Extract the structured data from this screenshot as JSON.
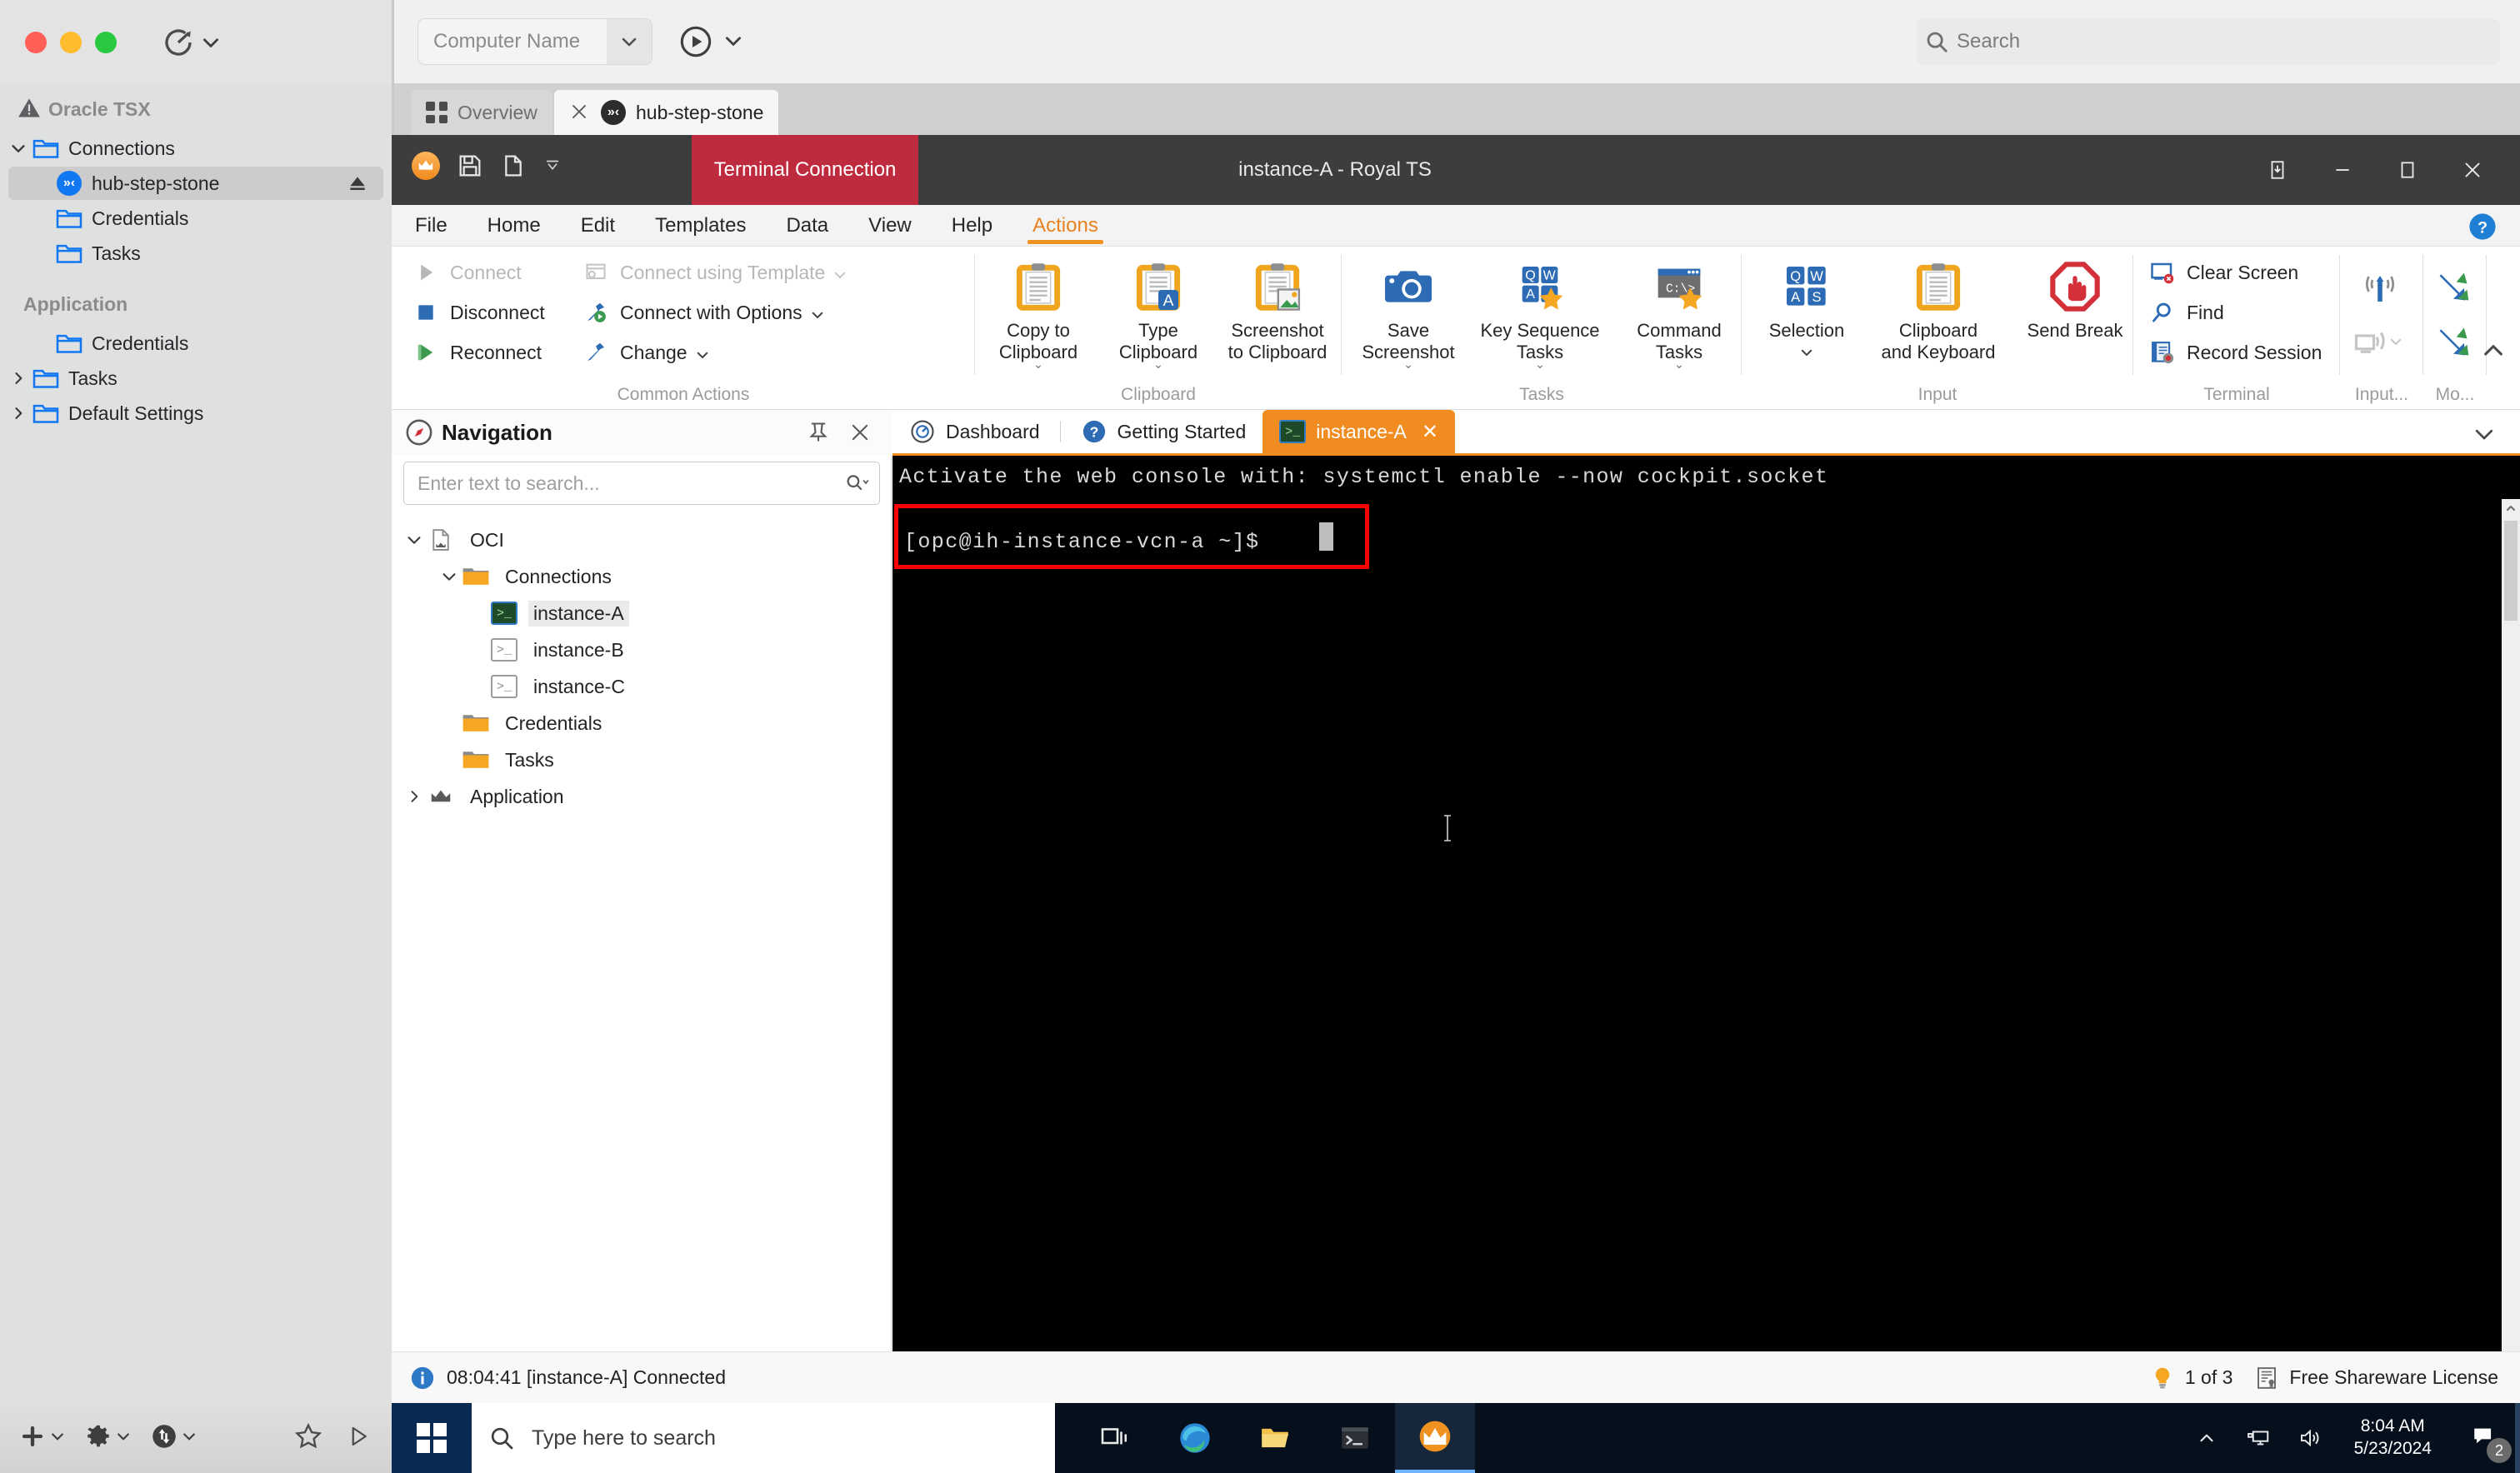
{
  "mac": {
    "toolbar": {
      "refresh_icon": "refresh-icon",
      "chevron_icon": "chevron-down-icon"
    },
    "sidebar": {
      "sections": [
        {
          "header": "Oracle TSX",
          "header_icon": "warning-triangle-icon",
          "items": [
            {
              "label": "Connections",
              "icon": "folder-icon",
              "chevron": "chevron-down-icon",
              "indent": 1,
              "selected": false
            },
            {
              "label": "hub-step-stone",
              "icon": "xshell-icon",
              "indent": 2,
              "selected": true,
              "trailing_icon": "eject-icon"
            },
            {
              "label": "Credentials",
              "icon": "folder-icon",
              "indent": 2,
              "selected": false
            },
            {
              "label": "Tasks",
              "icon": "folder-icon",
              "indent": 2,
              "selected": false
            }
          ]
        },
        {
          "header": "Application",
          "items": [
            {
              "label": "Credentials",
              "icon": "folder-icon",
              "indent": 2,
              "selected": false
            },
            {
              "label": "Tasks",
              "icon": "folder-icon",
              "chevron": "chevron-right-icon",
              "indent": 1,
              "selected": false
            },
            {
              "label": "Default Settings",
              "icon": "folder-icon",
              "chevron": "chevron-right-icon",
              "indent": 1,
              "selected": false
            }
          ]
        }
      ]
    },
    "bottombar": {
      "add_icon": "plus-icon",
      "settings_icon": "gear-icon",
      "transfer_icon": "transfer-icon",
      "favorite_icon": "star-icon",
      "run_icon": "play-triangle-icon"
    }
  },
  "vm": {
    "computer_name_placeholder": "Computer Name",
    "play_icon": "play-circle-icon",
    "search_placeholder": "Search",
    "search_icon": "search-icon",
    "tabs": [
      {
        "label": "Overview",
        "icon": "grid-icon",
        "active": false
      },
      {
        "label": "hub-step-stone",
        "icon": "xshell-icon",
        "active": true,
        "close_icon": "close-icon"
      }
    ]
  },
  "royalts": {
    "titlebar": {
      "badge": "Terminal Connection",
      "title": "instance-A - Royal TS",
      "quick_access": [
        "royal-logo-icon",
        "save-icon",
        "new-document-icon",
        "customize-chevron-icon"
      ],
      "window_controls": [
        "restore-down-icon",
        "minimize-icon",
        "maximize-icon",
        "close-icon"
      ]
    },
    "menubar": {
      "items": [
        "File",
        "Home",
        "Edit",
        "Templates",
        "Data",
        "View",
        "Help",
        "Actions"
      ],
      "active": "Actions",
      "help_icon": "help-circle-icon"
    },
    "ribbon": {
      "groups": [
        {
          "title": "Common Actions",
          "small_buttons": [
            {
              "label": "Connect",
              "icon": "play-triangle-icon",
              "disabled": true
            },
            {
              "label": "Disconnect",
              "icon": "stop-square-icon",
              "disabled": false
            },
            {
              "label": "Reconnect",
              "icon": "reconnect-icon",
              "disabled": false
            },
            {
              "label": "Connect using Template",
              "icon": "template-icon",
              "disabled": true,
              "chevron": "chevron-down-icon"
            },
            {
              "label": "Connect with Options",
              "icon": "wrench-play-icon",
              "disabled": false,
              "chevron": "chevron-down-icon"
            },
            {
              "label": "Change",
              "icon": "wrench-icon",
              "disabled": false,
              "chevron": "chevron-down-icon"
            }
          ]
        },
        {
          "title": "Clipboard",
          "big_buttons": [
            {
              "label": "Copy to\nClipboard",
              "icon": "clipboard-icon",
              "chevron": "chevron-down-icon"
            },
            {
              "label": "Type\nClipboard",
              "icon": "clipboard-type-icon",
              "chevron": "chevron-down-icon"
            },
            {
              "label": "Screenshot\nto Clipboard",
              "icon": "clipboard-image-icon"
            }
          ]
        },
        {
          "title": "Tasks",
          "big_buttons": [
            {
              "label": "Save\nScreenshot",
              "icon": "camera-icon",
              "chevron": "chevron-down-icon"
            },
            {
              "label": "Key Sequence\nTasks",
              "icon": "keys-star-icon",
              "chevron": "chevron-down-icon"
            },
            {
              "label": "Command\nTasks",
              "icon": "console-star-icon",
              "chevron": "chevron-down-icon"
            }
          ]
        },
        {
          "title": "Input",
          "big_buttons": [
            {
              "label": "Selection",
              "icon": "keys-icon",
              "chevron": "chevron-down-icon"
            },
            {
              "label": "Clipboard\nand Keyboard",
              "icon": "clipboard-icon",
              "chevron": "chevron-down-icon"
            },
            {
              "label": "Send Break",
              "icon": "stop-hand-icon"
            }
          ]
        },
        {
          "title": "Terminal",
          "small_buttons": [
            {
              "label": "Clear Screen",
              "icon": "clear-screen-icon"
            },
            {
              "label": "Find",
              "icon": "magnifier-icon"
            },
            {
              "label": "Record Session",
              "icon": "record-session-icon"
            }
          ]
        },
        {
          "title": "Input...",
          "icon_buttons": [
            {
              "icon": "broadcast-icon",
              "disabled": false
            },
            {
              "icon": "screen-broadcast-icon",
              "disabled": true,
              "chevron": "chevron-down-icon"
            }
          ]
        },
        {
          "title": "Mo...",
          "icon_buttons": [
            {
              "icon": "shuffle-icon",
              "disabled": false
            },
            {
              "icon": "shuffle-icon",
              "disabled": false
            }
          ]
        }
      ],
      "collapse_icon": "chevron-up-icon"
    },
    "navigation": {
      "title": "Navigation",
      "compass_icon": "compass-icon",
      "pin_icon": "pin-icon",
      "close_icon": "close-icon",
      "search_placeholder": "Enter text to search...",
      "search_icon": "search-dropdown-icon",
      "tree": [
        {
          "label": "OCI",
          "icon": "document-crown-icon",
          "chevron": "chevron-down-icon",
          "indent": 0,
          "selected": false
        },
        {
          "label": "Connections",
          "icon": "folder-orange-icon",
          "chevron": "chevron-down-icon",
          "indent": 1,
          "selected": false
        },
        {
          "label": "instance-A",
          "icon": "terminal-active-icon",
          "indent": 2,
          "selected": true
        },
        {
          "label": "instance-B",
          "icon": "terminal-icon",
          "indent": 2,
          "selected": false
        },
        {
          "label": "instance-C",
          "icon": "terminal-icon",
          "indent": 2,
          "selected": false
        },
        {
          "label": "Credentials",
          "icon": "folder-orange-icon",
          "indent": 1,
          "selected": false
        },
        {
          "label": "Tasks",
          "icon": "folder-orange-icon",
          "indent": 1,
          "selected": false
        },
        {
          "label": "Application",
          "icon": "crown-icon",
          "chevron": "chevron-right-icon",
          "indent": 0,
          "selected": false
        }
      ]
    },
    "terminal": {
      "tabs": [
        {
          "label": "Dashboard",
          "icon": "dashboard-icon",
          "active": false
        },
        {
          "label": "Getting Started",
          "icon": "question-icon",
          "active": false
        },
        {
          "label": "instance-A",
          "icon": "terminal-active-icon",
          "active": true,
          "close_icon": "close-icon"
        }
      ],
      "lines": [
        "Activate the web console with: systemctl enable --now cockpit.socket"
      ],
      "prompt": "[opc@ih-instance-vcn-a ~]$",
      "highlight_color": "#fe0000",
      "background": "#000000",
      "scrollbar": {
        "up_icon": "caret-up-icon",
        "down_icon": "caret-down-icon"
      }
    },
    "statusbar": {
      "info_icon": "info-icon",
      "message": "08:04:41 [instance-A] Connected",
      "bulb_icon": "lightbulb-icon",
      "count": "1 of 3",
      "license_icon": "certificate-icon",
      "license": "Free Shareware License"
    },
    "pane_collapse_icon": "chevron-down-icon"
  },
  "taskbar": {
    "start_icon": "windows-logo-icon",
    "search_placeholder": "Type here to search",
    "search_icon": "search-icon",
    "pinned": [
      {
        "icon": "task-view-icon",
        "active": false
      },
      {
        "icon": "edge-browser-icon",
        "active": false
      },
      {
        "icon": "file-explorer-icon",
        "active": false
      },
      {
        "icon": "terminal-icon",
        "active": false
      },
      {
        "icon": "royal-ts-icon",
        "active": true
      }
    ],
    "tray": {
      "overflow_icon": "chevron-up-icon",
      "network_icon": "network-icon",
      "volume_icon": "volume-icon",
      "time": "8:04 AM",
      "date": "5/23/2024",
      "notification_icon": "notification-icon",
      "notification_count": "2"
    }
  },
  "colors": {
    "accent_orange": "#f18c20",
    "badge_red": "#bf2b3e",
    "highlight_red": "#fe0000",
    "royal_blue": "#2f7cc4",
    "terminal_bg": "#000000"
  }
}
